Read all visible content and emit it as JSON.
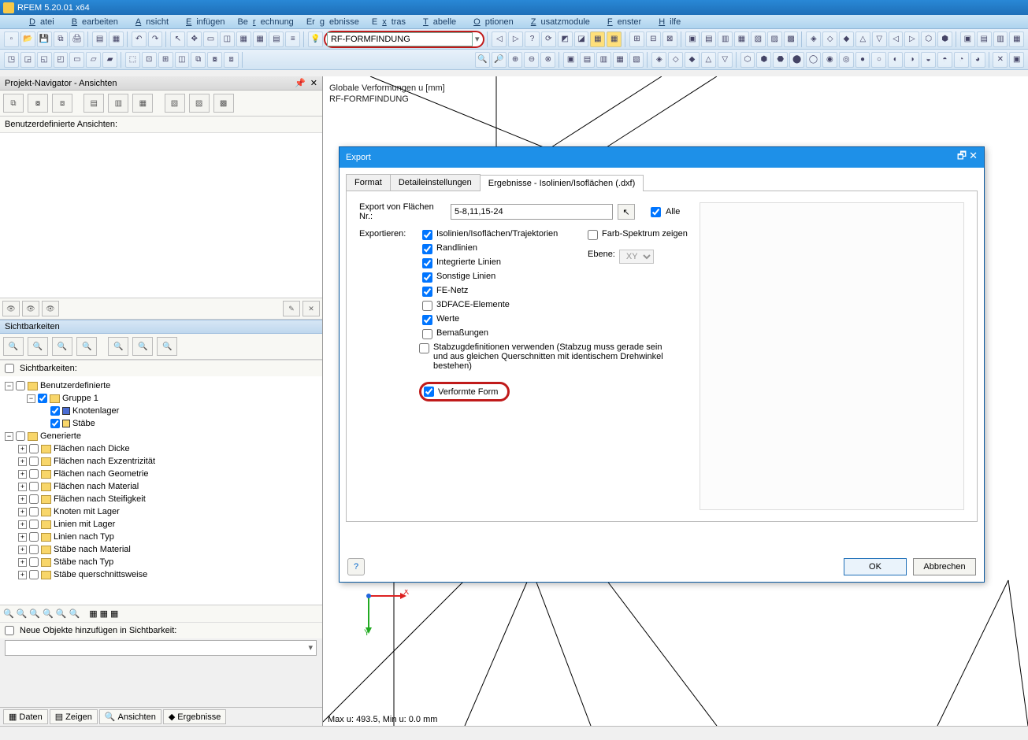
{
  "app": {
    "title": "RFEM 5.20.01 x64"
  },
  "menu": [
    "Datei",
    "Bearbeiten",
    "Ansicht",
    "Einfügen",
    "Berechnung",
    "Ergebnisse",
    "Extras",
    "Tabelle",
    "Optionen",
    "Zusatzmodule",
    "Fenster",
    "Hilfe"
  ],
  "toolbar2": {
    "combo_value": "RF-FORMFINDUNG"
  },
  "navigator": {
    "title": "Projekt-Navigator - Ansichten",
    "userviews_label": "Benutzerdefinierte Ansichten:",
    "visibilities_header": "Sichtbarkeiten",
    "visibilities_checkbox": "Sichtbarkeiten:",
    "add_objects_label": "Neue Objekte hinzufügen in Sichtbarkeit:",
    "tree": {
      "user_defined": "Benutzerdefinierte",
      "gruppe1": "Gruppe 1",
      "knotenlager": "Knotenlager",
      "staebe": "Stäbe",
      "generierte": "Generierte",
      "items": [
        "Flächen nach Dicke",
        "Flächen nach Exzentrizität",
        "Flächen nach Geometrie",
        "Flächen nach Material",
        "Flächen nach Steifigkeit",
        "Knoten mit Lager",
        "Linien mit Lager",
        "Linien nach Typ",
        "Stäbe nach Material",
        "Stäbe nach Typ",
        "Stäbe querschnittsweise"
      ]
    },
    "tabs": [
      "Daten",
      "Zeigen",
      "Ansichten",
      "Ergebnisse"
    ]
  },
  "viewport": {
    "label_line1": "Globale Verformungen u [mm]",
    "label_line2": "RF-FORMFINDUNG",
    "status": "Max u: 493.5, Min u: 0.0 mm"
  },
  "dialog": {
    "title": "Export",
    "tabs": [
      "Format",
      "Detaileinstellungen",
      "Ergebnisse - Isolinien/Isoflächen (.dxf)"
    ],
    "export_surfaces_label": "Export von Flächen Nr.:",
    "surfaces_value": "5-8,11,15-24",
    "alle_label": "Alle",
    "exportieren_label": "Exportieren:",
    "options": {
      "iso": "Isolinien/Isoflächen/Trajektorien",
      "rand": "Randlinien",
      "integ": "Integrierte Linien",
      "sonst": "Sonstige Linien",
      "fe": "FE-Netz",
      "face3d": "3DFACE-Elemente",
      "werte": "Werte",
      "bemass": "Bemaßungen",
      "stabzug_line1": "Stabzugdefinitionen verwenden (Stabzug muss gerade sein",
      "stabzug_line2": "und aus gleichen Querschnitten mit identischem Drehwinkel bestehen)",
      "verformte": "Verformte Form"
    },
    "farb_label": "Farb-Spektrum zeigen",
    "ebene_label": "Ebene:",
    "ebene_value": "XY",
    "ok": "OK",
    "cancel": "Abbrechen"
  }
}
